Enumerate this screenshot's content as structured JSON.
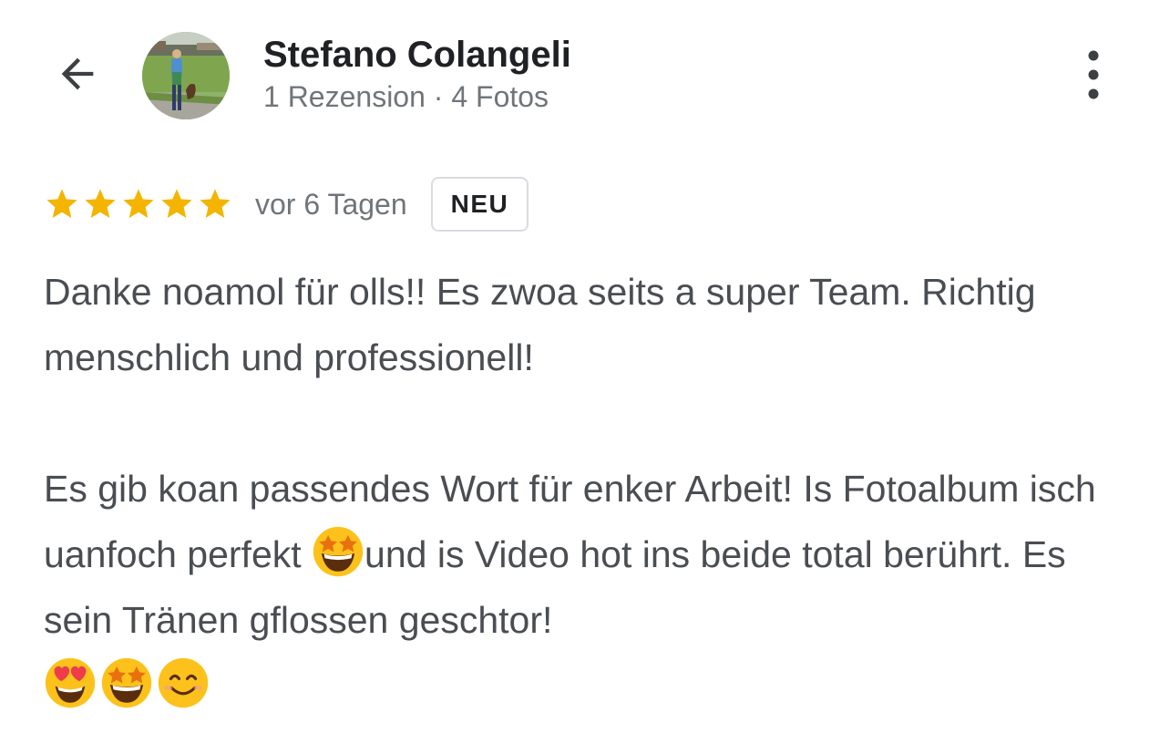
{
  "header": {
    "back_icon": "arrow-back-icon",
    "reviewer_name": "Stefano Colangeli",
    "reviewer_meta": "1 Rezension · 4 Fotos",
    "more_icon": "more-vert-icon"
  },
  "review": {
    "rating": 5,
    "rating_max": 5,
    "star_color": "#f4b400",
    "date": "vor 6 Tagen",
    "badge": "NEU",
    "paragraph_1": "Danke noamol für olls!! Es zwoa seits a super Team. Richtig menschlich und professionell!",
    "paragraph_2_part_1": "Es gib koan passendes Wort für enker Arbeit! Is Fotoalbum isch uanfoch perfekt ",
    "paragraph_2_part_2": "und is Video hot ins beide total berührt. Es sein Tränen gflossen geschtor!",
    "inline_emoji": "star-struck-emoji",
    "trailing_emojis": [
      "heart-eyes-emoji",
      "star-struck-emoji",
      "smiling-face-emoji"
    ]
  }
}
